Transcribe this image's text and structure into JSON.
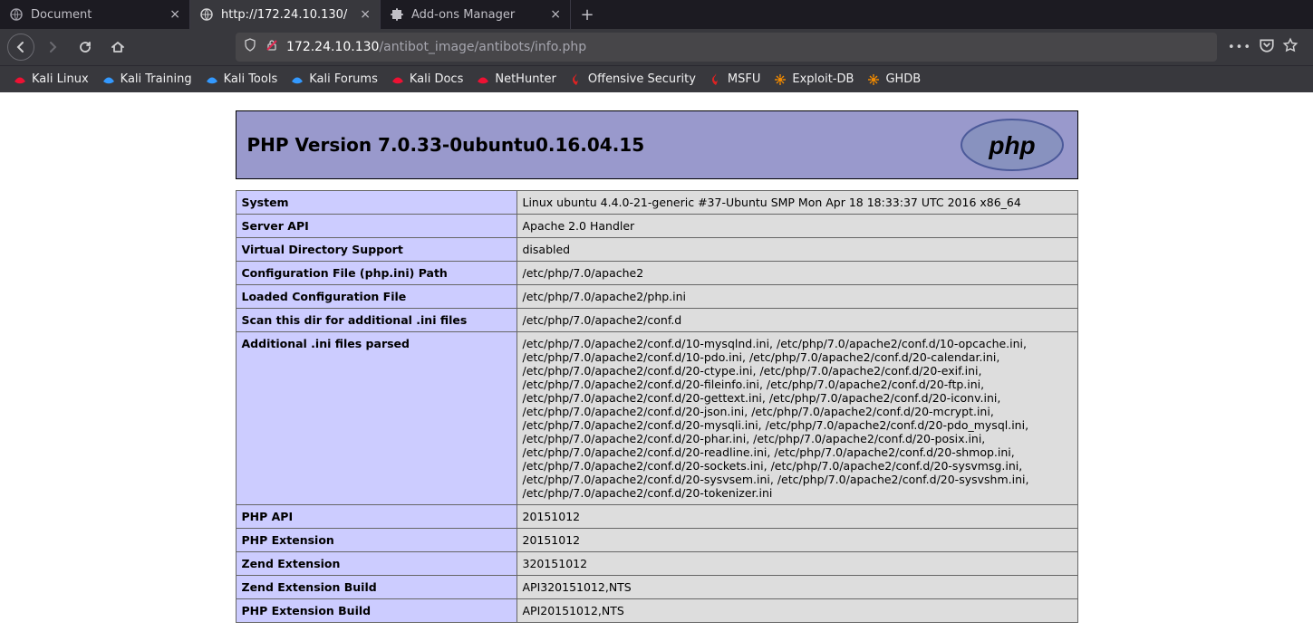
{
  "browser": {
    "tabs": [
      {
        "title": "Document",
        "active": false,
        "favicon": "globe"
      },
      {
        "title": "http://172.24.10.130/",
        "active": true,
        "favicon": "globe"
      },
      {
        "title": "Add-ons Manager",
        "active": false,
        "favicon": "puzzle"
      }
    ],
    "url": {
      "host": "172.24.10.130",
      "path": "/antibot_image/antibots/info.php"
    },
    "bookmarks": [
      {
        "label": "Kali Linux",
        "icon": "kali-red"
      },
      {
        "label": "Kali Training",
        "icon": "kali-blue"
      },
      {
        "label": "Kali Tools",
        "icon": "kali-blue"
      },
      {
        "label": "Kali Forums",
        "icon": "kali-blue"
      },
      {
        "label": "Kali Docs",
        "icon": "kali-red"
      },
      {
        "label": "NetHunter",
        "icon": "kali-red"
      },
      {
        "label": "Offensive Security",
        "icon": "flame-red"
      },
      {
        "label": "MSFU",
        "icon": "flame-red"
      },
      {
        "label": "Exploit-DB",
        "icon": "spider-orange"
      },
      {
        "label": "GHDB",
        "icon": "spider-orange"
      }
    ]
  },
  "php": {
    "header": "PHP Version 7.0.33-0ubuntu0.16.04.15",
    "rows": [
      {
        "k": "System",
        "v": "Linux ubuntu 4.4.0-21-generic #37-Ubuntu SMP Mon Apr 18 18:33:37 UTC 2016 x86_64"
      },
      {
        "k": "Server API",
        "v": "Apache 2.0 Handler"
      },
      {
        "k": "Virtual Directory Support",
        "v": "disabled"
      },
      {
        "k": "Configuration File (php.ini) Path",
        "v": "/etc/php/7.0/apache2"
      },
      {
        "k": "Loaded Configuration File",
        "v": "/etc/php/7.0/apache2/php.ini"
      },
      {
        "k": "Scan this dir for additional .ini files",
        "v": "/etc/php/7.0/apache2/conf.d"
      },
      {
        "k": "Additional .ini files parsed",
        "v": "/etc/php/7.0/apache2/conf.d/10-mysqlnd.ini, /etc/php/7.0/apache2/conf.d/10-opcache.ini, /etc/php/7.0/apache2/conf.d/10-pdo.ini, /etc/php/7.0/apache2/conf.d/20-calendar.ini, /etc/php/7.0/apache2/conf.d/20-ctype.ini, /etc/php/7.0/apache2/conf.d/20-exif.ini, /etc/php/7.0/apache2/conf.d/20-fileinfo.ini, /etc/php/7.0/apache2/conf.d/20-ftp.ini, /etc/php/7.0/apache2/conf.d/20-gettext.ini, /etc/php/7.0/apache2/conf.d/20-iconv.ini, /etc/php/7.0/apache2/conf.d/20-json.ini, /etc/php/7.0/apache2/conf.d/20-mcrypt.ini, /etc/php/7.0/apache2/conf.d/20-mysqli.ini, /etc/php/7.0/apache2/conf.d/20-pdo_mysql.ini, /etc/php/7.0/apache2/conf.d/20-phar.ini, /etc/php/7.0/apache2/conf.d/20-posix.ini, /etc/php/7.0/apache2/conf.d/20-readline.ini, /etc/php/7.0/apache2/conf.d/20-shmop.ini, /etc/php/7.0/apache2/conf.d/20-sockets.ini, /etc/php/7.0/apache2/conf.d/20-sysvmsg.ini, /etc/php/7.0/apache2/conf.d/20-sysvsem.ini, /etc/php/7.0/apache2/conf.d/20-sysvshm.ini, /etc/php/7.0/apache2/conf.d/20-tokenizer.ini"
      },
      {
        "k": "PHP API",
        "v": "20151012"
      },
      {
        "k": "PHP Extension",
        "v": "20151012"
      },
      {
        "k": "Zend Extension",
        "v": "320151012"
      },
      {
        "k": "Zend Extension Build",
        "v": "API320151012,NTS"
      },
      {
        "k": "PHP Extension Build",
        "v": "API20151012,NTS"
      }
    ]
  }
}
